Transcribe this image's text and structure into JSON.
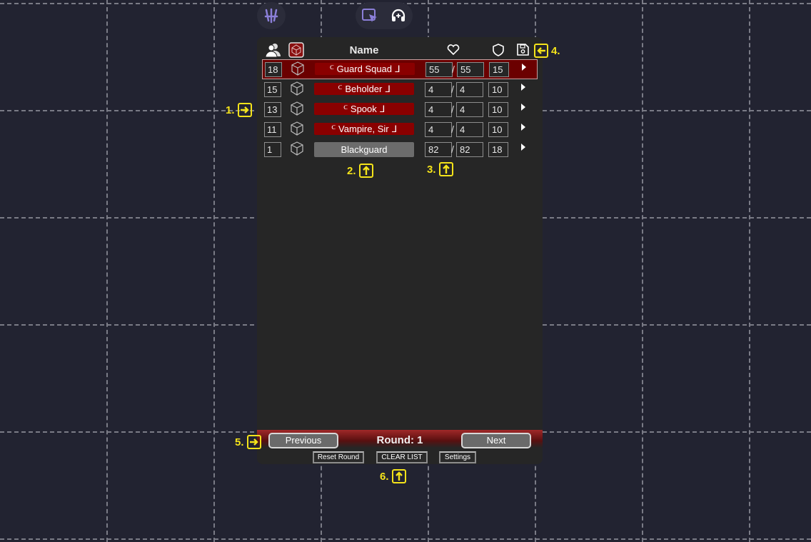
{
  "toolbar": {
    "logo_icon": "claw-logo-icon",
    "select_icon": "cursor-select-icon",
    "headset_icon": "headset-icon",
    "accent": "#8b7fd8"
  },
  "header": {
    "name_label": "Name",
    "party_icon": "party-icon",
    "roll_icon": "roll-initiative-icon",
    "hp_icon": "heart-icon",
    "ac_icon": "shield-icon",
    "save_icon": "save-icon"
  },
  "combatants": [
    {
      "initiative": "18",
      "name": "ᒼ Guard Squad ᒧ",
      "hp": "55",
      "max_hp": "55",
      "ac": "15",
      "active": true,
      "style": "enemy"
    },
    {
      "initiative": "15",
      "name": "ᒼ Beholder ᒧ",
      "hp": "4",
      "max_hp": "4",
      "ac": "10",
      "active": false,
      "style": "enemy"
    },
    {
      "initiative": "13",
      "name": "ᒼ Spook ᒧ",
      "hp": "4",
      "max_hp": "4",
      "ac": "10",
      "active": false,
      "style": "enemy"
    },
    {
      "initiative": "11",
      "name": "ᒼ Vampire, Sir ᒧ",
      "hp": "4",
      "max_hp": "4",
      "ac": "10",
      "active": false,
      "style": "enemy"
    },
    {
      "initiative": "1",
      "name": "Blackguard",
      "hp": "82",
      "max_hp": "82",
      "ac": "18",
      "active": false,
      "style": "plain"
    }
  ],
  "footer": {
    "previous_label": "Previous",
    "round_label": "Round: 1",
    "next_label": "Next",
    "reset_round_label": "Reset Round",
    "clear_list_label": "CLEAR LIST",
    "settings_label": "Settings"
  },
  "annotations": {
    "a1": "1.",
    "a2": "2.",
    "a3": "3.",
    "a4": "4.",
    "a5": "5.",
    "a6": "6."
  },
  "colors": {
    "background": "#222331",
    "panel": "#262626",
    "enemy_name": "#8a0000",
    "active_row": "#6b0000",
    "annotation": "#f4e31a"
  }
}
